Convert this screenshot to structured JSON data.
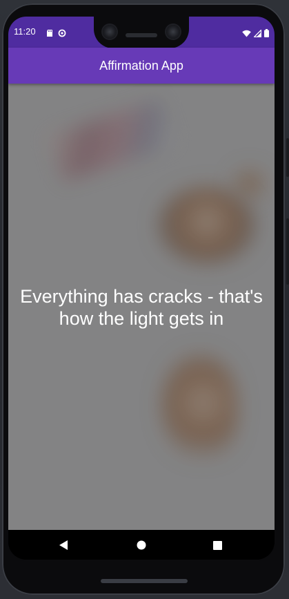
{
  "status_bar": {
    "time": "11:20",
    "left_icons": [
      "sd-card-icon",
      "sync-icon"
    ],
    "right_icons": [
      "wifi-icon",
      "cellular-icon",
      "battery-icon"
    ],
    "color": "#4f2ca0"
  },
  "app_bar": {
    "title": "Affirmation App",
    "color": "#673ab7"
  },
  "main": {
    "affirmation_text": "Everything has cracks - that's how the light gets in"
  },
  "nav_bar": {
    "buttons": [
      "back-icon",
      "home-icon",
      "recents-icon"
    ]
  }
}
